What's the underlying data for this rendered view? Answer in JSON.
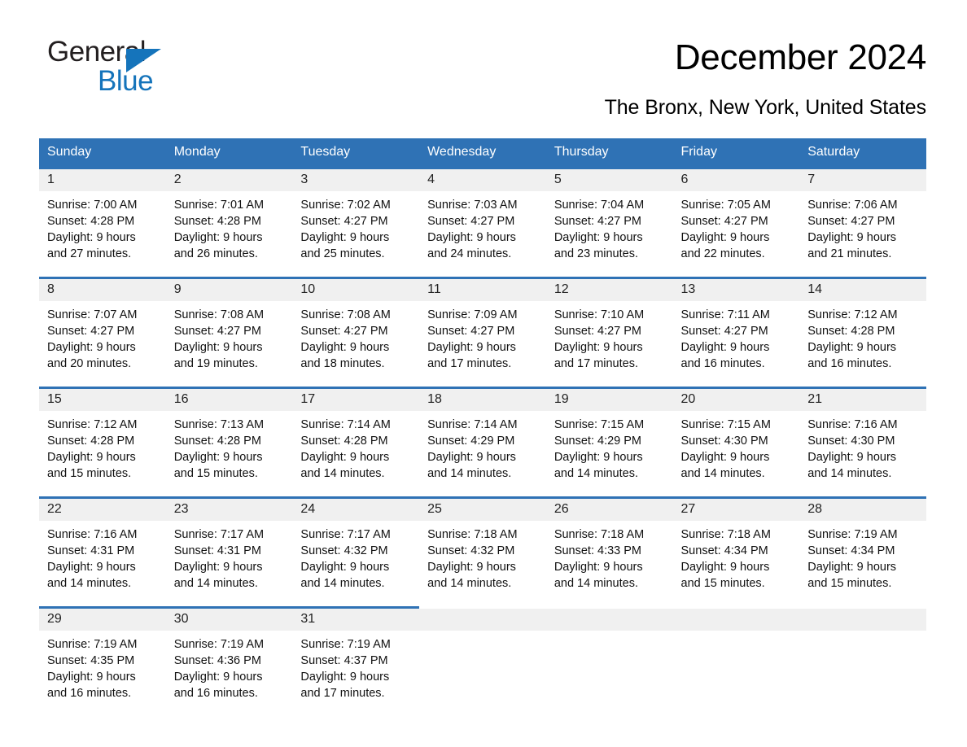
{
  "brand": {
    "name_top": "General",
    "name_bottom": "Blue",
    "accent_color": "#1574bb"
  },
  "header": {
    "title": "December 2024",
    "subtitle": "The Bronx, New York, United States"
  },
  "theme": {
    "header_bg": "#2f72b5",
    "daynum_bg": "#f0f0f0",
    "page_bg": "#ffffff",
    "text": "#000000"
  },
  "calendar": {
    "weekdays": [
      "Sunday",
      "Monday",
      "Tuesday",
      "Wednesday",
      "Thursday",
      "Friday",
      "Saturday"
    ],
    "weeks": [
      [
        {
          "day": "1",
          "sunrise": "Sunrise: 7:00 AM",
          "sunset": "Sunset: 4:28 PM",
          "daylight_1": "Daylight: 9 hours",
          "daylight_2": "and 27 minutes."
        },
        {
          "day": "2",
          "sunrise": "Sunrise: 7:01 AM",
          "sunset": "Sunset: 4:28 PM",
          "daylight_1": "Daylight: 9 hours",
          "daylight_2": "and 26 minutes."
        },
        {
          "day": "3",
          "sunrise": "Sunrise: 7:02 AM",
          "sunset": "Sunset: 4:27 PM",
          "daylight_1": "Daylight: 9 hours",
          "daylight_2": "and 25 minutes."
        },
        {
          "day": "4",
          "sunrise": "Sunrise: 7:03 AM",
          "sunset": "Sunset: 4:27 PM",
          "daylight_1": "Daylight: 9 hours",
          "daylight_2": "and 24 minutes."
        },
        {
          "day": "5",
          "sunrise": "Sunrise: 7:04 AM",
          "sunset": "Sunset: 4:27 PM",
          "daylight_1": "Daylight: 9 hours",
          "daylight_2": "and 23 minutes."
        },
        {
          "day": "6",
          "sunrise": "Sunrise: 7:05 AM",
          "sunset": "Sunset: 4:27 PM",
          "daylight_1": "Daylight: 9 hours",
          "daylight_2": "and 22 minutes."
        },
        {
          "day": "7",
          "sunrise": "Sunrise: 7:06 AM",
          "sunset": "Sunset: 4:27 PM",
          "daylight_1": "Daylight: 9 hours",
          "daylight_2": "and 21 minutes."
        }
      ],
      [
        {
          "day": "8",
          "sunrise": "Sunrise: 7:07 AM",
          "sunset": "Sunset: 4:27 PM",
          "daylight_1": "Daylight: 9 hours",
          "daylight_2": "and 20 minutes."
        },
        {
          "day": "9",
          "sunrise": "Sunrise: 7:08 AM",
          "sunset": "Sunset: 4:27 PM",
          "daylight_1": "Daylight: 9 hours",
          "daylight_2": "and 19 minutes."
        },
        {
          "day": "10",
          "sunrise": "Sunrise: 7:08 AM",
          "sunset": "Sunset: 4:27 PM",
          "daylight_1": "Daylight: 9 hours",
          "daylight_2": "and 18 minutes."
        },
        {
          "day": "11",
          "sunrise": "Sunrise: 7:09 AM",
          "sunset": "Sunset: 4:27 PM",
          "daylight_1": "Daylight: 9 hours",
          "daylight_2": "and 17 minutes."
        },
        {
          "day": "12",
          "sunrise": "Sunrise: 7:10 AM",
          "sunset": "Sunset: 4:27 PM",
          "daylight_1": "Daylight: 9 hours",
          "daylight_2": "and 17 minutes."
        },
        {
          "day": "13",
          "sunrise": "Sunrise: 7:11 AM",
          "sunset": "Sunset: 4:27 PM",
          "daylight_1": "Daylight: 9 hours",
          "daylight_2": "and 16 minutes."
        },
        {
          "day": "14",
          "sunrise": "Sunrise: 7:12 AM",
          "sunset": "Sunset: 4:28 PM",
          "daylight_1": "Daylight: 9 hours",
          "daylight_2": "and 16 minutes."
        }
      ],
      [
        {
          "day": "15",
          "sunrise": "Sunrise: 7:12 AM",
          "sunset": "Sunset: 4:28 PM",
          "daylight_1": "Daylight: 9 hours",
          "daylight_2": "and 15 minutes."
        },
        {
          "day": "16",
          "sunrise": "Sunrise: 7:13 AM",
          "sunset": "Sunset: 4:28 PM",
          "daylight_1": "Daylight: 9 hours",
          "daylight_2": "and 15 minutes."
        },
        {
          "day": "17",
          "sunrise": "Sunrise: 7:14 AM",
          "sunset": "Sunset: 4:28 PM",
          "daylight_1": "Daylight: 9 hours",
          "daylight_2": "and 14 minutes."
        },
        {
          "day": "18",
          "sunrise": "Sunrise: 7:14 AM",
          "sunset": "Sunset: 4:29 PM",
          "daylight_1": "Daylight: 9 hours",
          "daylight_2": "and 14 minutes."
        },
        {
          "day": "19",
          "sunrise": "Sunrise: 7:15 AM",
          "sunset": "Sunset: 4:29 PM",
          "daylight_1": "Daylight: 9 hours",
          "daylight_2": "and 14 minutes."
        },
        {
          "day": "20",
          "sunrise": "Sunrise: 7:15 AM",
          "sunset": "Sunset: 4:30 PM",
          "daylight_1": "Daylight: 9 hours",
          "daylight_2": "and 14 minutes."
        },
        {
          "day": "21",
          "sunrise": "Sunrise: 7:16 AM",
          "sunset": "Sunset: 4:30 PM",
          "daylight_1": "Daylight: 9 hours",
          "daylight_2": "and 14 minutes."
        }
      ],
      [
        {
          "day": "22",
          "sunrise": "Sunrise: 7:16 AM",
          "sunset": "Sunset: 4:31 PM",
          "daylight_1": "Daylight: 9 hours",
          "daylight_2": "and 14 minutes."
        },
        {
          "day": "23",
          "sunrise": "Sunrise: 7:17 AM",
          "sunset": "Sunset: 4:31 PM",
          "daylight_1": "Daylight: 9 hours",
          "daylight_2": "and 14 minutes."
        },
        {
          "day": "24",
          "sunrise": "Sunrise: 7:17 AM",
          "sunset": "Sunset: 4:32 PM",
          "daylight_1": "Daylight: 9 hours",
          "daylight_2": "and 14 minutes."
        },
        {
          "day": "25",
          "sunrise": "Sunrise: 7:18 AM",
          "sunset": "Sunset: 4:32 PM",
          "daylight_1": "Daylight: 9 hours",
          "daylight_2": "and 14 minutes."
        },
        {
          "day": "26",
          "sunrise": "Sunrise: 7:18 AM",
          "sunset": "Sunset: 4:33 PM",
          "daylight_1": "Daylight: 9 hours",
          "daylight_2": "and 14 minutes."
        },
        {
          "day": "27",
          "sunrise": "Sunrise: 7:18 AM",
          "sunset": "Sunset: 4:34 PM",
          "daylight_1": "Daylight: 9 hours",
          "daylight_2": "and 15 minutes."
        },
        {
          "day": "28",
          "sunrise": "Sunrise: 7:19 AM",
          "sunset": "Sunset: 4:34 PM",
          "daylight_1": "Daylight: 9 hours",
          "daylight_2": "and 15 minutes."
        }
      ],
      [
        {
          "day": "29",
          "sunrise": "Sunrise: 7:19 AM",
          "sunset": "Sunset: 4:35 PM",
          "daylight_1": "Daylight: 9 hours",
          "daylight_2": "and 16 minutes."
        },
        {
          "day": "30",
          "sunrise": "Sunrise: 7:19 AM",
          "sunset": "Sunset: 4:36 PM",
          "daylight_1": "Daylight: 9 hours",
          "daylight_2": "and 16 minutes."
        },
        {
          "day": "31",
          "sunrise": "Sunrise: 7:19 AM",
          "sunset": "Sunset: 4:37 PM",
          "daylight_1": "Daylight: 9 hours",
          "daylight_2": "and 17 minutes."
        },
        {
          "day": "",
          "sunrise": "",
          "sunset": "",
          "daylight_1": "",
          "daylight_2": ""
        },
        {
          "day": "",
          "sunrise": "",
          "sunset": "",
          "daylight_1": "",
          "daylight_2": ""
        },
        {
          "day": "",
          "sunrise": "",
          "sunset": "",
          "daylight_1": "",
          "daylight_2": ""
        },
        {
          "day": "",
          "sunrise": "",
          "sunset": "",
          "daylight_1": "",
          "daylight_2": ""
        }
      ]
    ]
  }
}
